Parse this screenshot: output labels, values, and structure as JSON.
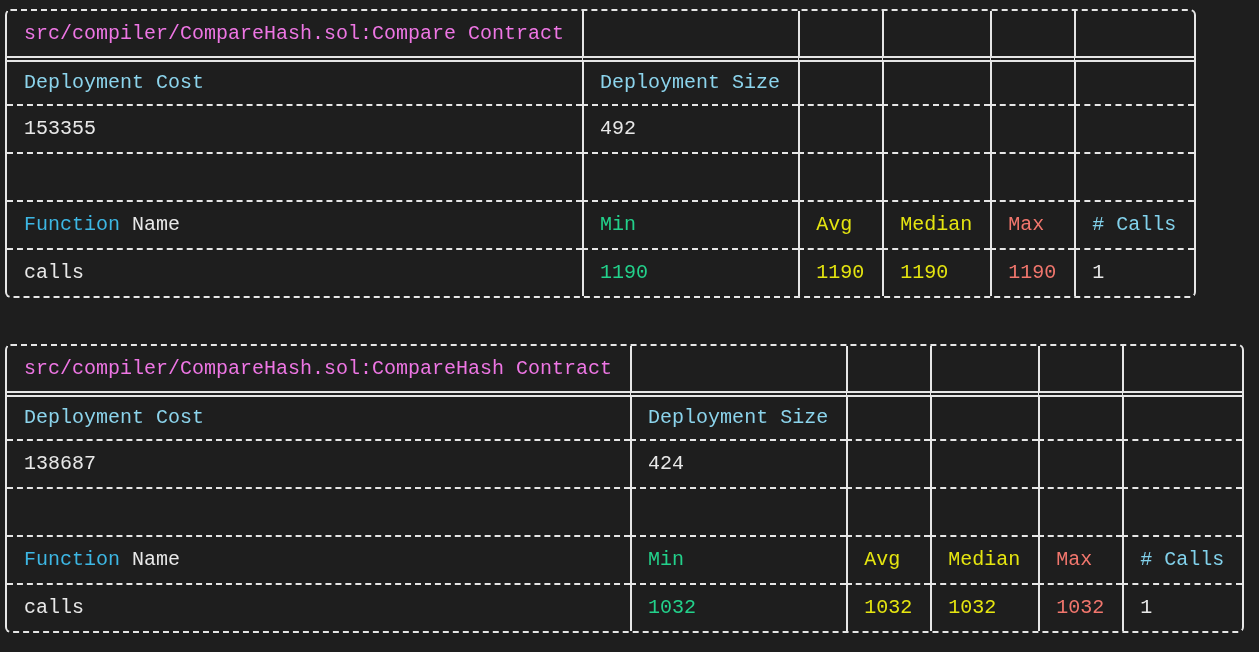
{
  "reports": [
    {
      "title": "src/compiler/CompareHash.sol:Compare Contract",
      "deployment_headers": [
        "Deployment Cost",
        "Deployment Size"
      ],
      "deployment_values": [
        "153355",
        "492"
      ],
      "function_headers": [
        {
          "parts": [
            {
              "text": "Function",
              "color": "#3db7e4"
            },
            {
              "text": "Name",
              "color": "#e8e8e8"
            }
          ]
        },
        {
          "text": "Min",
          "color": "#23d18b"
        },
        {
          "text": "Avg",
          "color": "#e5e510"
        },
        {
          "text": "Median",
          "color": "#e5e510"
        },
        {
          "text": "Max",
          "color": "#f1766d"
        },
        {
          "text": "# Calls",
          "color": "#82d2ec"
        }
      ],
      "function_rows": [
        [
          {
            "text": "calls",
            "color": "#e8e8e8"
          },
          {
            "text": "1190",
            "color": "#23d18b"
          },
          {
            "text": "1190",
            "color": "#e5e510"
          },
          {
            "text": "1190",
            "color": "#e5e510"
          },
          {
            "text": "1190",
            "color": "#f1766d"
          },
          {
            "text": "1",
            "color": "#e8e8e8"
          }
        ]
      ]
    },
    {
      "title": "src/compiler/CompareHash.sol:CompareHash Contract",
      "deployment_headers": [
        "Deployment Cost",
        "Deployment Size"
      ],
      "deployment_values": [
        "138687",
        "424"
      ],
      "function_headers": [
        {
          "parts": [
            {
              "text": "Function",
              "color": "#3db7e4"
            },
            {
              "text": "Name",
              "color": "#e8e8e8"
            }
          ]
        },
        {
          "text": "Min",
          "color": "#23d18b"
        },
        {
          "text": "Avg",
          "color": "#e5e510"
        },
        {
          "text": "Median",
          "color": "#e5e510"
        },
        {
          "text": "Max",
          "color": "#f1766d"
        },
        {
          "text": "# Calls",
          "color": "#82d2ec"
        }
      ],
      "function_rows": [
        [
          {
            "text": "calls",
            "color": "#e8e8e8"
          },
          {
            "text": "1032",
            "color": "#23d18b"
          },
          {
            "text": "1032",
            "color": "#e5e510"
          },
          {
            "text": "1032",
            "color": "#e5e510"
          },
          {
            "text": "1032",
            "color": "#f1766d"
          },
          {
            "text": "1",
            "color": "#e8e8e8"
          }
        ]
      ]
    }
  ]
}
